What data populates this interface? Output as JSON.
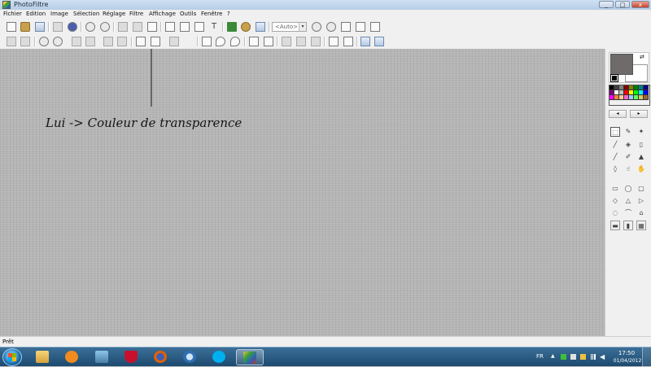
{
  "window": {
    "title": "PhotoFiltre",
    "minimize": "_",
    "maximize": "□",
    "close": "x"
  },
  "menu": [
    "Fichier",
    "Edition",
    "Image",
    "Sélection",
    "Réglage",
    "Filtre",
    "Affichage",
    "Outils",
    "Fenêtre",
    "?"
  ],
  "toolbar": {
    "zoom_value": "<Auto>",
    "text_tool_glyph": "T"
  },
  "annotation": {
    "text": "Lui -> Couleur de transparence"
  },
  "palette": {
    "foreground_color": "#6e6b6a",
    "background_color": "#ffffff",
    "swatches": [
      "#000000",
      "#3f3f3f",
      "#7f7f7f",
      "#800000",
      "#808000",
      "#008000",
      "#008080",
      "#000080",
      "#800080",
      "#ffffff",
      "#bfbfbf",
      "#ff0000",
      "#ffff00",
      "#00ff00",
      "#00ffff",
      "#0000ff",
      "#ff00ff",
      "#ff8040",
      "#ffcc99",
      "#ff66cc",
      "#99ccff",
      "#66ff66",
      "#cccc66",
      "#996633"
    ],
    "prev_glyph": "◂",
    "next_glyph": "▸"
  },
  "status": {
    "text": "Prêt"
  },
  "taskbar": {
    "apps": [
      "explorer-icon",
      "media-player-icon",
      "network-icon",
      "mcafee-icon",
      "firefox-icon",
      "thunderbird-icon",
      "skype-icon",
      "photofiltre-icon"
    ],
    "language": "FR",
    "time": "17:50",
    "date": "01/04/2012"
  },
  "colors": {
    "accent": "#2b5fb8",
    "taskbar": "#1d4a6f"
  }
}
